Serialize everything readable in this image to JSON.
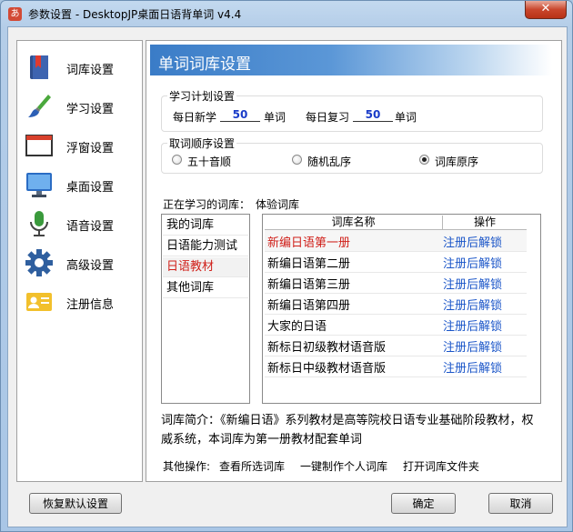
{
  "window": {
    "title": "参数设置 - DesktopJP桌面日语背单词 v4.4",
    "app_icon_glyph": "あ",
    "close_glyph": "✕"
  },
  "sidebar": {
    "items": [
      {
        "label": "词库设置",
        "icon": "book-icon"
      },
      {
        "label": "学习设置",
        "icon": "brush-icon"
      },
      {
        "label": "浮窗设置",
        "icon": "window-icon"
      },
      {
        "label": "桌面设置",
        "icon": "monitor-icon"
      },
      {
        "label": "语音设置",
        "icon": "microphone-icon"
      },
      {
        "label": "高级设置",
        "icon": "gear-icon"
      },
      {
        "label": "注册信息",
        "icon": "id-card-icon"
      }
    ]
  },
  "panel": {
    "title": "单词词库设置",
    "plan": {
      "label": "学习计划设置",
      "new_label": "每日新学",
      "new_value": "50",
      "new_unit": "单词",
      "review_label": "每日复习",
      "review_value": "50",
      "review_unit": "单词"
    },
    "order": {
      "label": "取词顺序设置",
      "options": [
        "五十音顺",
        "随机乱序",
        "词库原序"
      ],
      "selected": "词库原序"
    },
    "current_label": "正在学习的词库：",
    "current_value": "体验词库",
    "categories": [
      "我的词库",
      "日语能力测试",
      "日语教材",
      "其他词库"
    ],
    "selected_category": "日语教材",
    "table": {
      "headers": [
        "词库名称",
        "操作"
      ],
      "rows": [
        {
          "name": "新编日语第一册",
          "action": "注册后解锁",
          "selected": true
        },
        {
          "name": "新编日语第二册",
          "action": "注册后解锁"
        },
        {
          "name": "新编日语第三册",
          "action": "注册后解锁"
        },
        {
          "name": "新编日语第四册",
          "action": "注册后解锁"
        },
        {
          "name": "大家的日语",
          "action": "注册后解锁"
        },
        {
          "name": "新标日初级教材语音版",
          "action": "注册后解锁"
        },
        {
          "name": "新标日中级教材语音版",
          "action": "注册后解锁"
        }
      ]
    },
    "description": "词库简介：《新编日语》系列教材是高等院校日语专业基础阶段教材，权威系统，本词库为第一册教材配套单词",
    "other_ops_label": "其他操作:",
    "other_ops": [
      "查看所选词库",
      "一键制作个人词库",
      "打开词库文件夹"
    ]
  },
  "buttons": {
    "restore": "恢复默认设置",
    "ok": "确定",
    "cancel": "取消"
  },
  "colors": {
    "header_blue": "#3a7cc7",
    "selected_red": "#d0201a",
    "link_blue": "#1a55c8"
  }
}
